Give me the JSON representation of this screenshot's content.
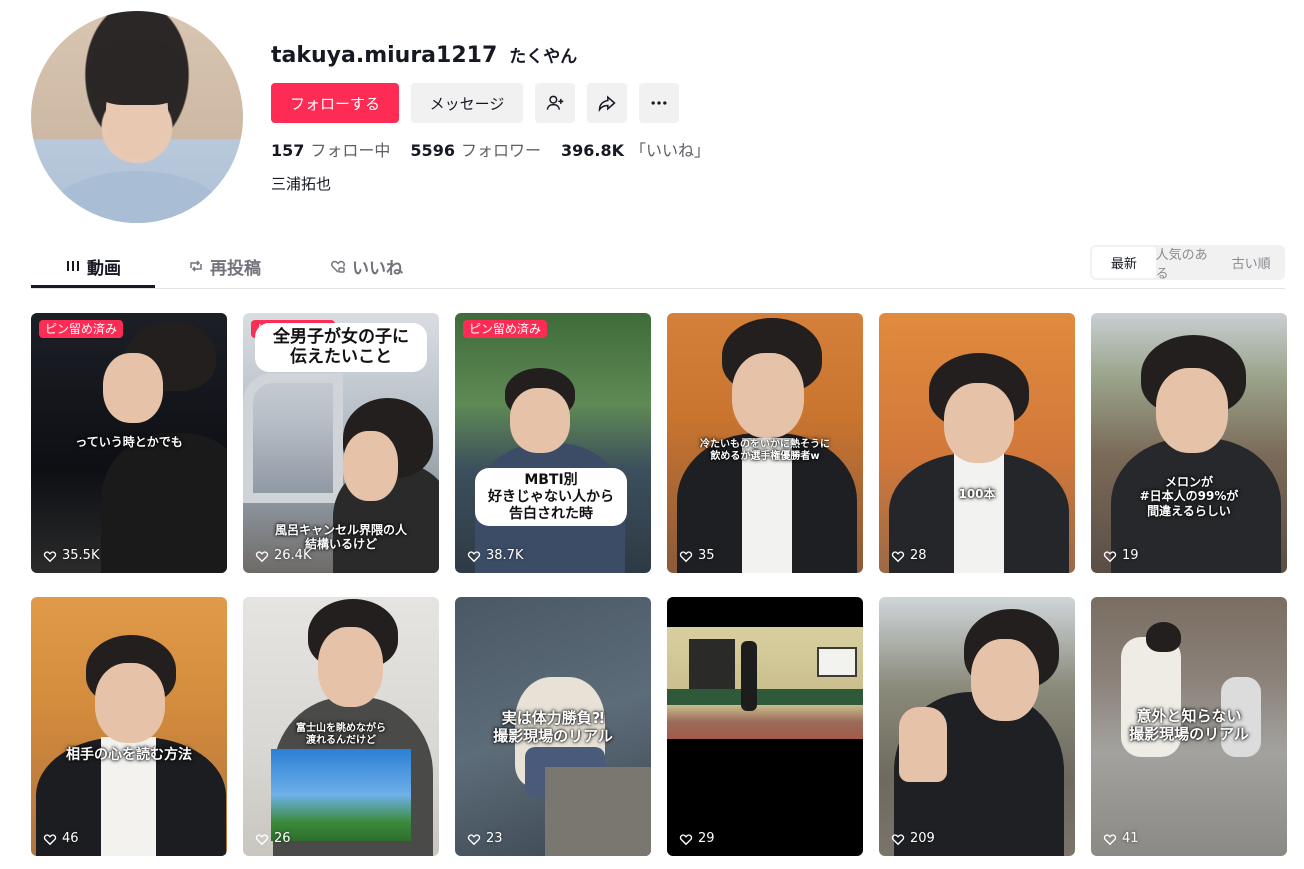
{
  "profile": {
    "username": "takuya.miura1217",
    "nickname": "たくやん",
    "follow_label": "フォローする",
    "message_label": "メッセージ",
    "bio": "三浦拓也"
  },
  "stats": [
    {
      "value": "157",
      "label": "フォロー中"
    },
    {
      "value": "5596",
      "label": "フォロワー"
    },
    {
      "value": "396.8K",
      "label": "「いいね」"
    }
  ],
  "tabs": [
    {
      "label": "動画",
      "icon": "grid-icon"
    },
    {
      "label": "再投稿",
      "icon": "repost-icon"
    },
    {
      "label": "いいね",
      "icon": "heart-lock-icon"
    }
  ],
  "sort": [
    "最新",
    "人気のある",
    "古い順"
  ],
  "pin_label": "ピン留め済み",
  "videos": [
    {
      "likes": "35.5K",
      "pinned": true,
      "caption": "っていう時とかでも"
    },
    {
      "likes": "26.4K",
      "pinned": true,
      "caption": "全男子が女の子に\n伝えたいこと",
      "caption2": "風呂キャンセル界隈の人\n結構いるけど"
    },
    {
      "likes": "38.7K",
      "pinned": true,
      "caption": "MBTI別\n好きじゃない人から\n告白された時"
    },
    {
      "likes": "35",
      "pinned": false,
      "caption": "冷たいものをいかに熱そうに\n飲めるか選手権優勝者w"
    },
    {
      "likes": "28",
      "pinned": false,
      "caption": "100本"
    },
    {
      "likes": "19",
      "pinned": false,
      "caption": "メロンが\n#日本人の99%が\n間違えるらしい"
    },
    {
      "likes": "46",
      "pinned": false,
      "caption": "相手の心を読む方法"
    },
    {
      "likes": "26",
      "pinned": false,
      "caption": "富士山を眺めながら\n渡れるんだけど"
    },
    {
      "likes": "23",
      "pinned": false,
      "caption": "実は体力勝負⁈\n撮影現場のリアル"
    },
    {
      "likes": "29",
      "pinned": false,
      "caption": ""
    },
    {
      "likes": "209",
      "pinned": false,
      "caption": ""
    },
    {
      "likes": "41",
      "pinned": false,
      "caption": "意外と知らない\n撮影現場のリアル"
    }
  ],
  "colors": {
    "accent": "#fe2c55",
    "text": "#161823",
    "muted": "#73747b"
  }
}
